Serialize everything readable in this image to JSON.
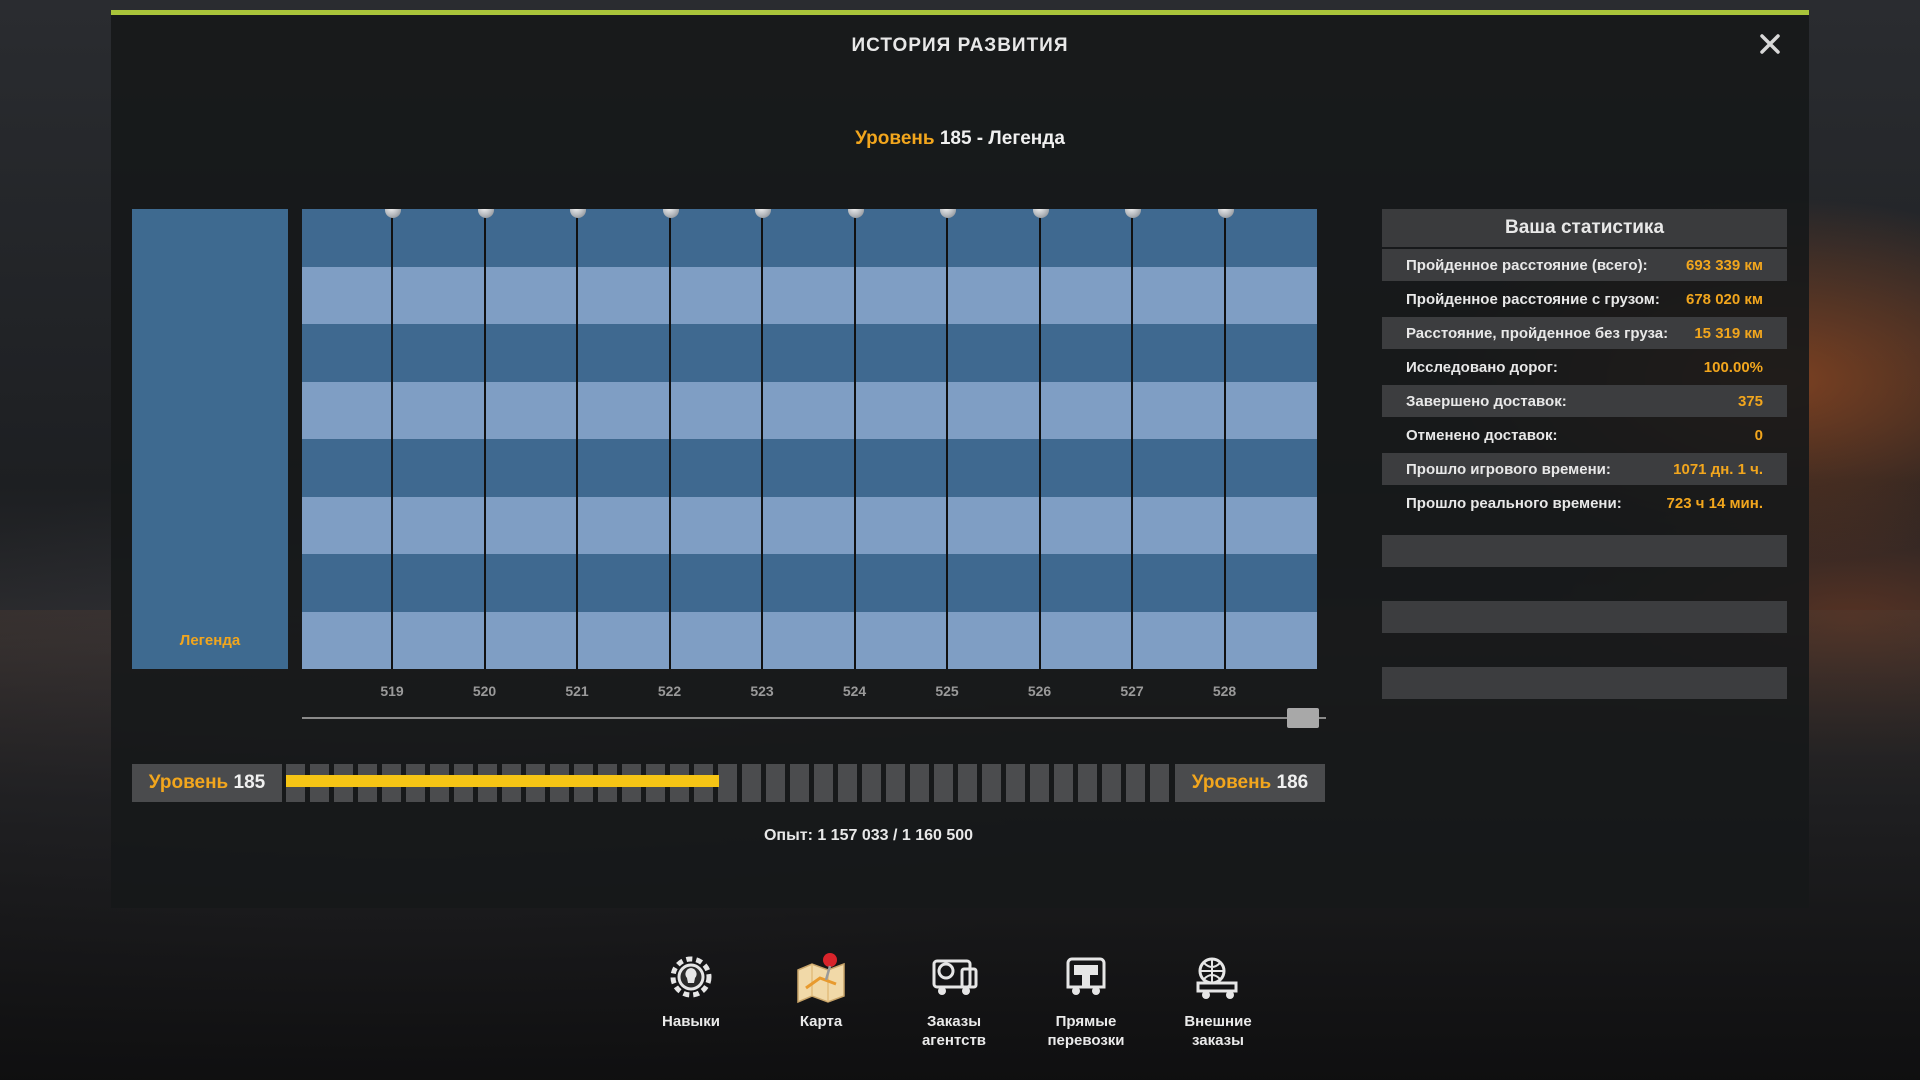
{
  "window": {
    "title": "ИСТОРИЯ РАЗВИТИЯ",
    "close_label": "✕"
  },
  "level_heading": {
    "prefix": "Уровень",
    "level": "185",
    "suffix": " - Легенда"
  },
  "legend": {
    "label": "Легенда"
  },
  "chart_data": {
    "type": "table",
    "columns": [
      "519",
      "520",
      "521",
      "522",
      "523",
      "524",
      "525",
      "526",
      "527",
      "528"
    ],
    "rows": 8
  },
  "xp": {
    "left_level_label": "Уровень",
    "left_level_value": "185",
    "right_level_label": "Уровень",
    "right_level_value": "186",
    "current": 1157033,
    "target": 1160500,
    "fill_fraction": 0.49,
    "text": "Опыт: 1 157 033 / 1 160 500"
  },
  "stats": {
    "title": "Ваша статистика",
    "rows": [
      {
        "label": "Пройденное расстояние (всего):",
        "value": "693 339 км"
      },
      {
        "label": "Пройденное расстояние с грузом:",
        "value": "678 020 км"
      },
      {
        "label": "Расстояние, пройденное без груза:",
        "value": "15 319 км"
      },
      {
        "label": "Исследовано дорог:",
        "value": "100.00%"
      },
      {
        "label": "Завершено доставок:",
        "value": "375"
      },
      {
        "label": "Отменено доставок:",
        "value": "0"
      },
      {
        "label": "Прошло игрового времени:",
        "value": "1071 дн. 1 ч."
      },
      {
        "label": "Прошло реального времени:",
        "value": "723 ч 14 мин."
      }
    ]
  },
  "nav": [
    {
      "label": "Навыки",
      "icon": "skills-gear-icon"
    },
    {
      "label": "Карта",
      "icon": "map-pin-icon"
    },
    {
      "label": "Заказы\nагентств",
      "icon": "agency-orders-icon"
    },
    {
      "label": "Прямые\nперевозки",
      "icon": "direct-transport-icon"
    },
    {
      "label": "Внешние\nзаказы",
      "icon": "external-orders-icon"
    }
  ],
  "colors": {
    "accent_top": "#a9c43a",
    "orange": "#f2a61d",
    "xp_fill": "#f6c515",
    "band_dark": "#3f6990",
    "band_light": "#7f9ec4"
  }
}
